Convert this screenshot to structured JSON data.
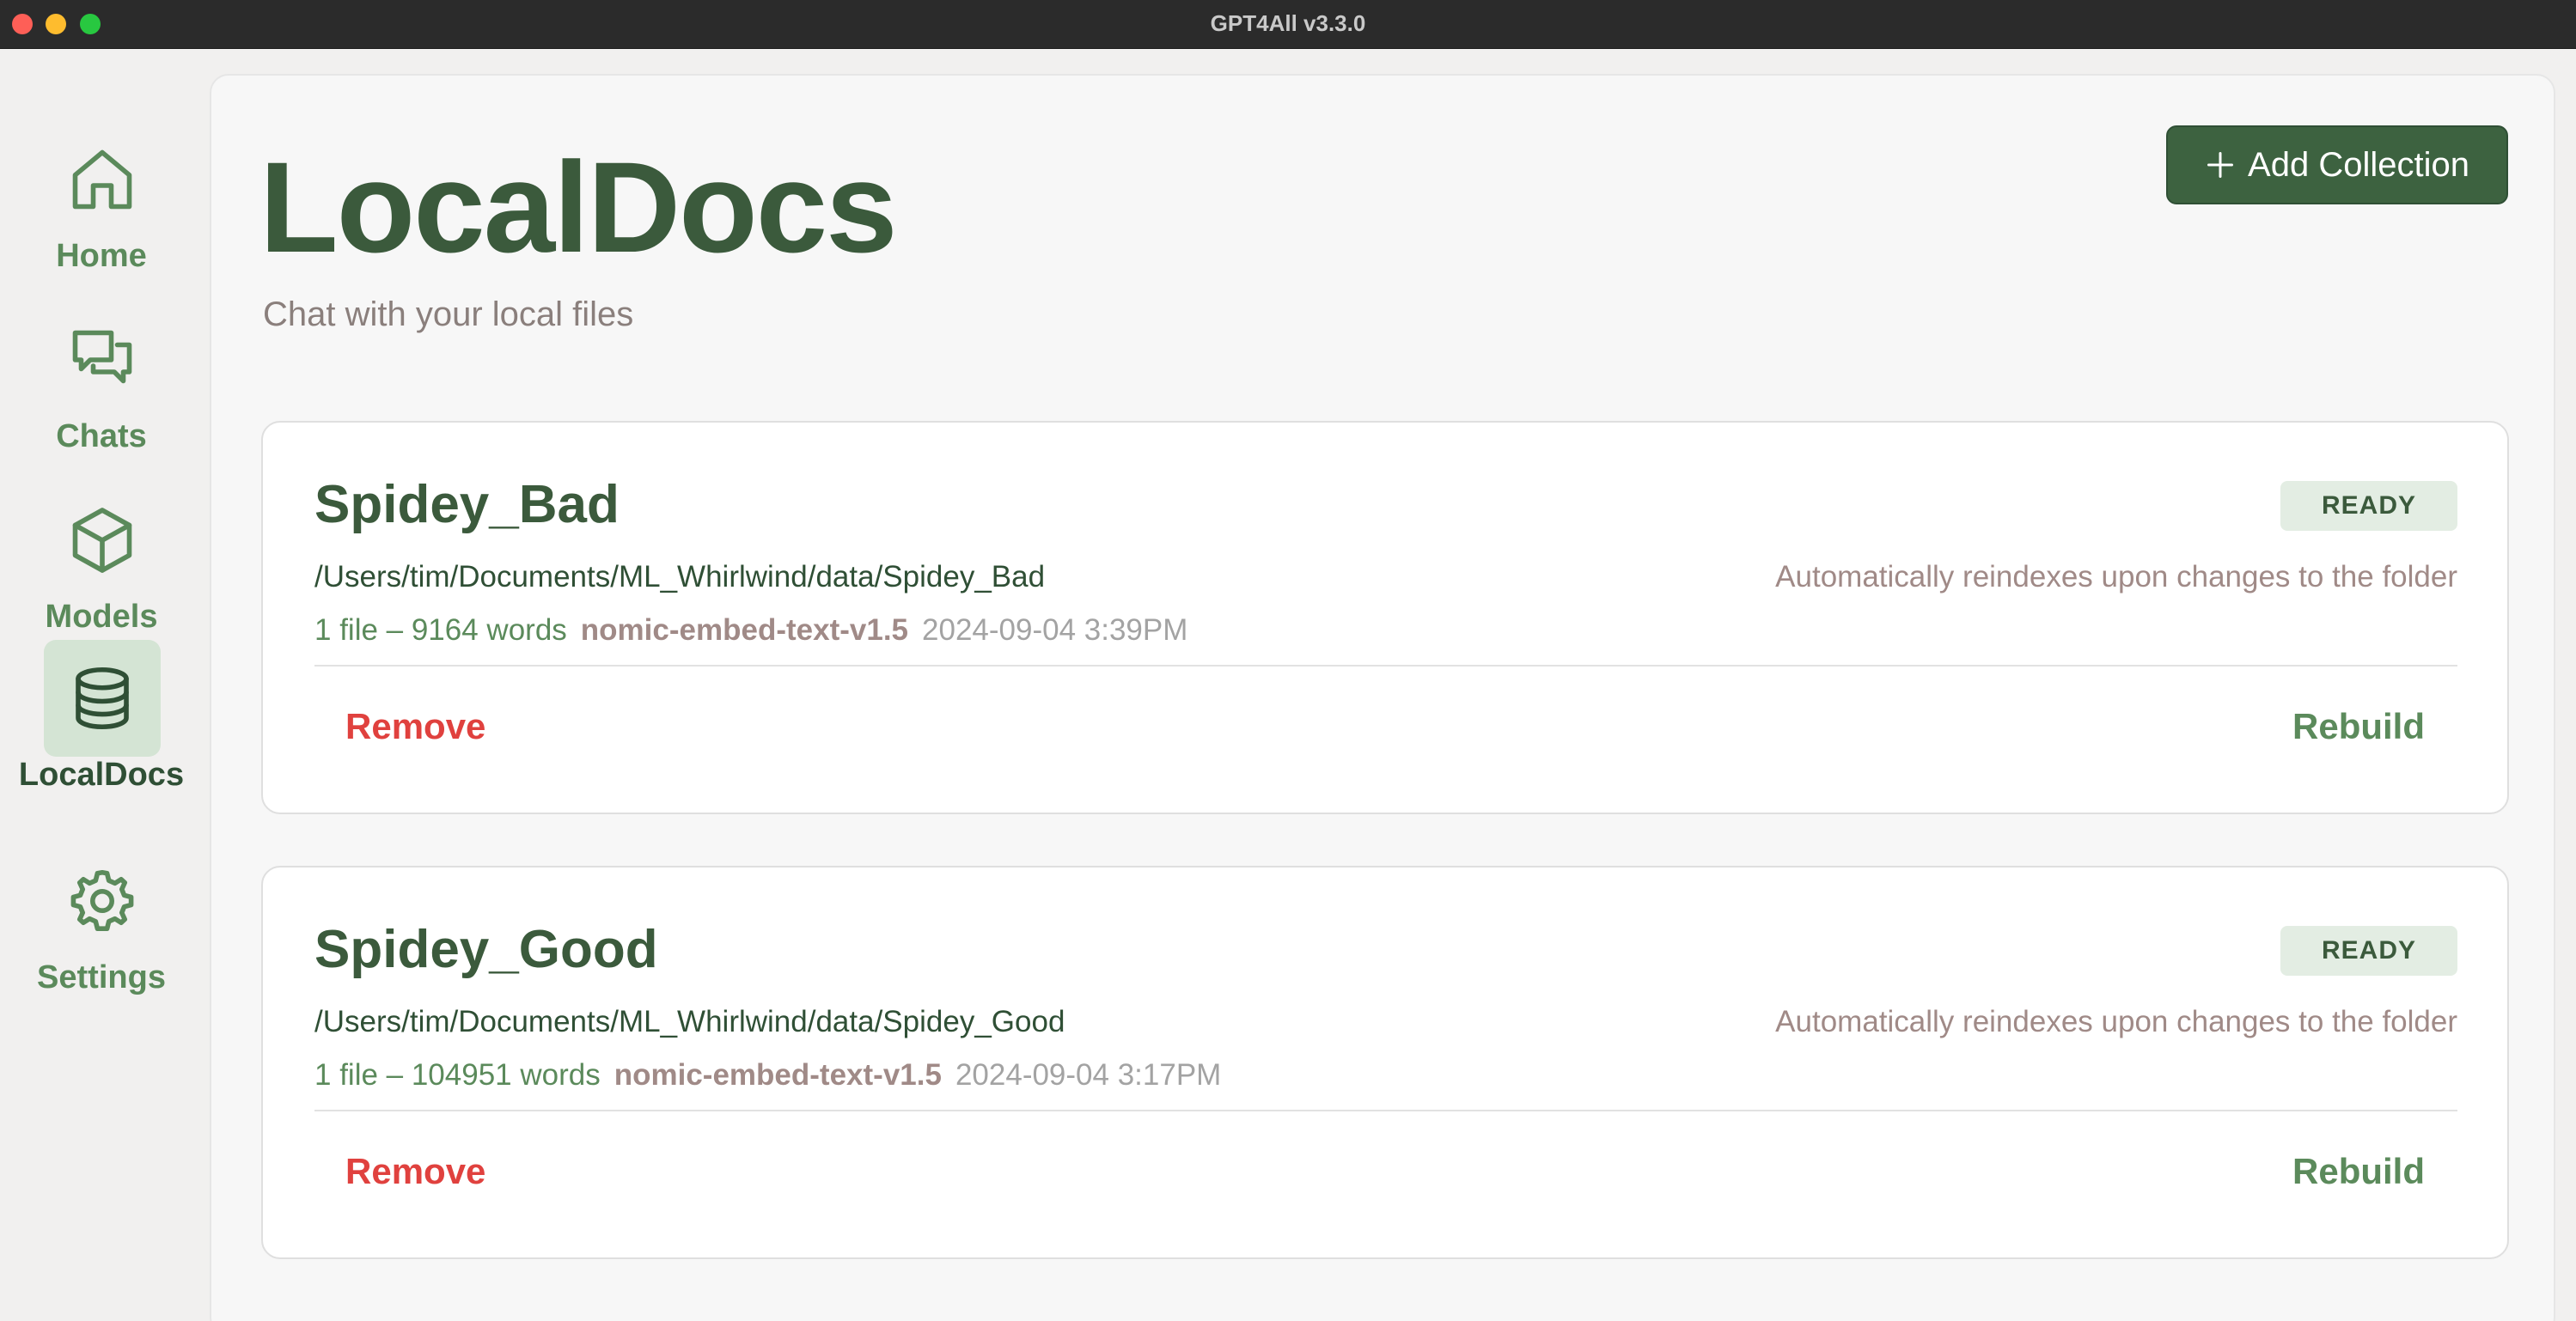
{
  "window": {
    "title": "GPT4All v3.3.0"
  },
  "sidebar": {
    "items": [
      {
        "label": "Home",
        "icon": "home-icon",
        "active": false
      },
      {
        "label": "Chats",
        "icon": "chats-icon",
        "active": false
      },
      {
        "label": "Models",
        "icon": "cube-icon",
        "active": false
      },
      {
        "label": "LocalDocs",
        "icon": "database-icon",
        "active": true
      },
      {
        "label": "Settings",
        "icon": "gear-icon",
        "active": false
      }
    ]
  },
  "header": {
    "title": "LocalDocs",
    "subtitle": "Chat with your local files",
    "add_button_label": "Add Collection"
  },
  "collections": [
    {
      "name": "Spidey_Bad",
      "status": "READY",
      "path": "/Users/tim/Documents/ML_Whirlwind/data/Spidey_Bad",
      "reindex_note": "Automatically reindexes upon changes to the folder",
      "counts": "1 file – 9164 words",
      "embedding_model": "nomic-embed-text-v1.5",
      "timestamp": "2024-09-04 3:39PM",
      "remove_label": "Remove",
      "rebuild_label": "Rebuild"
    },
    {
      "name": "Spidey_Good",
      "status": "READY",
      "path": "/Users/tim/Documents/ML_Whirlwind/data/Spidey_Good",
      "reindex_note": "Automatically reindexes upon changes to the folder",
      "counts": "1 file – 104951 words",
      "embedding_model": "nomic-embed-text-v1.5",
      "timestamp": "2024-09-04 3:17PM",
      "remove_label": "Remove",
      "rebuild_label": "Rebuild"
    }
  ],
  "colors": {
    "accent_green": "#3d6240",
    "label_green": "#5b8a5b",
    "remove_red": "#e0413e",
    "active_bg": "#d4e4d4"
  }
}
